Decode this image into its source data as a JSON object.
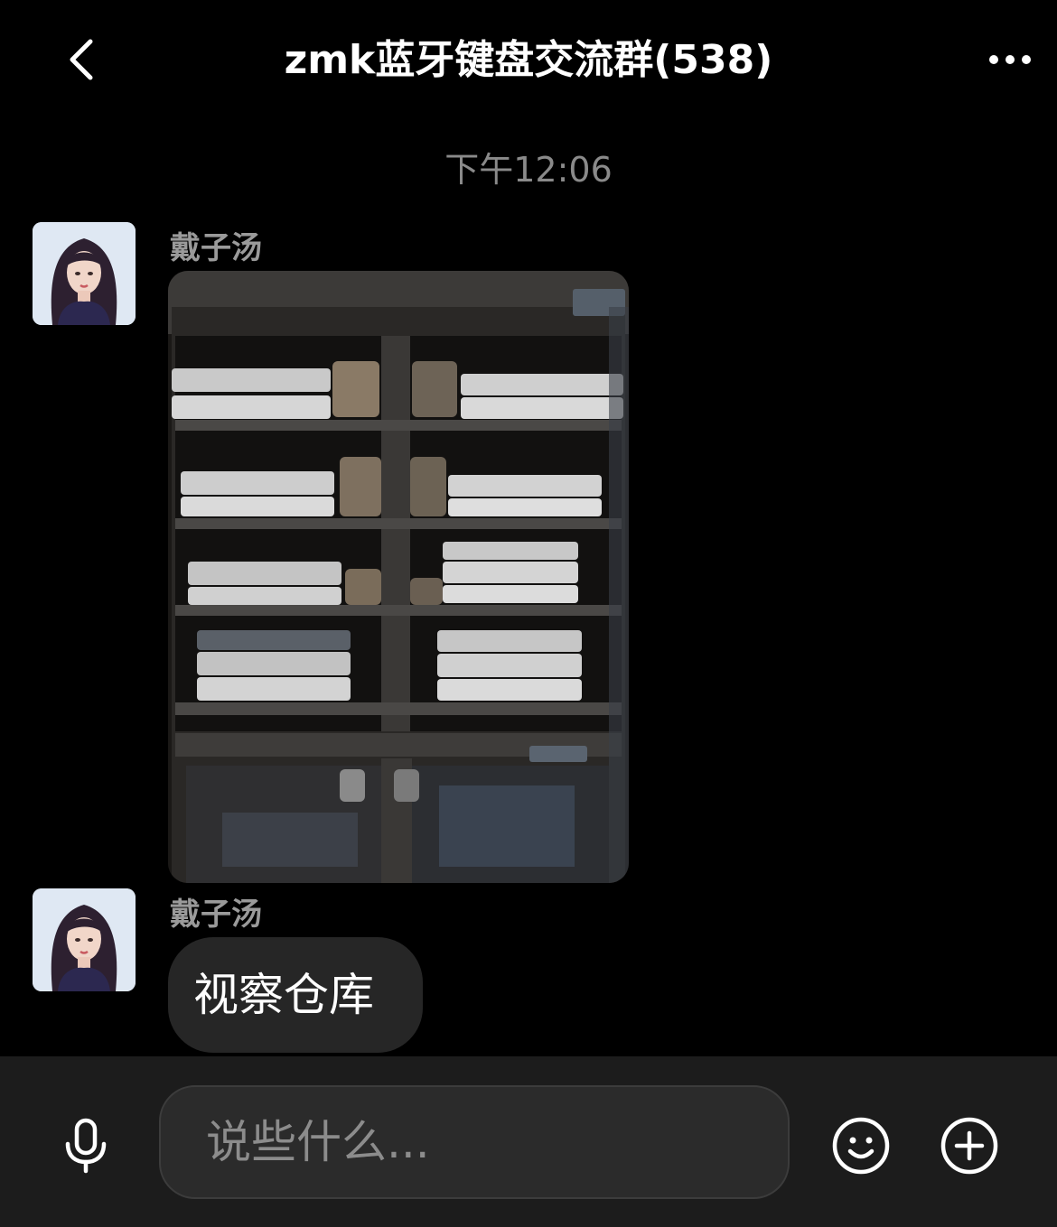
{
  "header": {
    "title": "zmk蓝牙键盘交流群(538)",
    "back_icon": "chevron-left-icon",
    "more_icon": "more-horizontal-icon"
  },
  "chat": {
    "timestamp": "下午12:06",
    "messages": [
      {
        "sender": "戴子汤",
        "type": "image",
        "image_description_icon": "photo-icon"
      },
      {
        "sender": "戴子汤",
        "type": "text",
        "text": "视察仓库"
      }
    ]
  },
  "input_bar": {
    "placeholder": "说些什么...",
    "voice_icon": "microphone-icon",
    "emoji_icon": "emoji-smile-icon",
    "plus_icon": "plus-circle-icon"
  },
  "colors": {
    "background": "#000000",
    "bubble": "#262626",
    "input_bar": "#1c1c1c",
    "muted_text": "#8a8a8a"
  }
}
